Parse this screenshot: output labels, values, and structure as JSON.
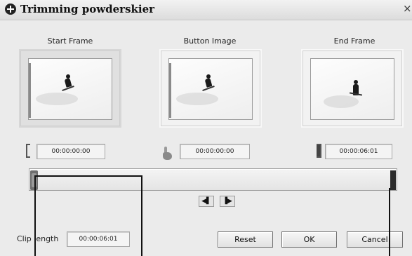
{
  "window": {
    "title": "Trimming powderskier",
    "close_glyph": "×"
  },
  "frames": {
    "start": {
      "label": "Start Frame",
      "timecode": "00:00:00:00"
    },
    "button_image": {
      "label": "Button Image",
      "timecode": "00:00:00:00"
    },
    "end": {
      "label": "End Frame",
      "timecode": "00:00:06:01"
    }
  },
  "clip_length": {
    "label": "Clip length",
    "value": "00:00:06:01"
  },
  "buttons": {
    "reset": "Reset",
    "ok": "OK",
    "cancel": "Cancel"
  },
  "step_buttons": {
    "back": "◀▌",
    "forward": "▐▶"
  },
  "icons": {
    "title": "disc-icon",
    "start_marker": "start-bracket-icon",
    "button_marker": "hand-icon",
    "end_marker": "end-bracket-icon"
  }
}
